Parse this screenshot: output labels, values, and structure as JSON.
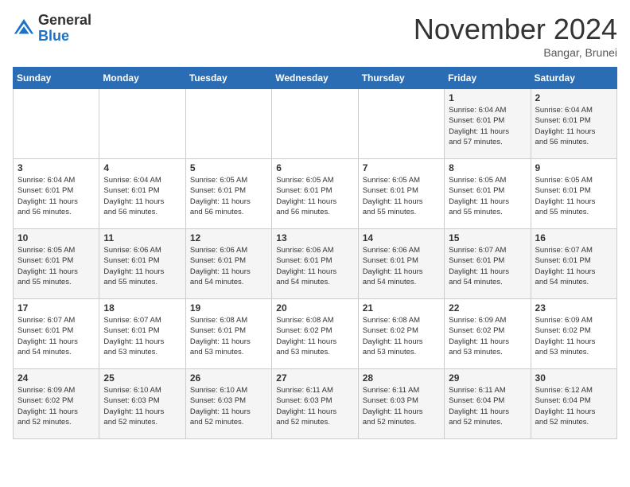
{
  "header": {
    "logo_general": "General",
    "logo_blue": "Blue",
    "month_title": "November 2024",
    "location": "Bangar, Brunei"
  },
  "weekdays": [
    "Sunday",
    "Monday",
    "Tuesday",
    "Wednesday",
    "Thursday",
    "Friday",
    "Saturday"
  ],
  "weeks": [
    [
      {
        "day": "",
        "info": ""
      },
      {
        "day": "",
        "info": ""
      },
      {
        "day": "",
        "info": ""
      },
      {
        "day": "",
        "info": ""
      },
      {
        "day": "",
        "info": ""
      },
      {
        "day": "1",
        "info": "Sunrise: 6:04 AM\nSunset: 6:01 PM\nDaylight: 11 hours\nand 57 minutes."
      },
      {
        "day": "2",
        "info": "Sunrise: 6:04 AM\nSunset: 6:01 PM\nDaylight: 11 hours\nand 56 minutes."
      }
    ],
    [
      {
        "day": "3",
        "info": "Sunrise: 6:04 AM\nSunset: 6:01 PM\nDaylight: 11 hours\nand 56 minutes."
      },
      {
        "day": "4",
        "info": "Sunrise: 6:04 AM\nSunset: 6:01 PM\nDaylight: 11 hours\nand 56 minutes."
      },
      {
        "day": "5",
        "info": "Sunrise: 6:05 AM\nSunset: 6:01 PM\nDaylight: 11 hours\nand 56 minutes."
      },
      {
        "day": "6",
        "info": "Sunrise: 6:05 AM\nSunset: 6:01 PM\nDaylight: 11 hours\nand 56 minutes."
      },
      {
        "day": "7",
        "info": "Sunrise: 6:05 AM\nSunset: 6:01 PM\nDaylight: 11 hours\nand 55 minutes."
      },
      {
        "day": "8",
        "info": "Sunrise: 6:05 AM\nSunset: 6:01 PM\nDaylight: 11 hours\nand 55 minutes."
      },
      {
        "day": "9",
        "info": "Sunrise: 6:05 AM\nSunset: 6:01 PM\nDaylight: 11 hours\nand 55 minutes."
      }
    ],
    [
      {
        "day": "10",
        "info": "Sunrise: 6:05 AM\nSunset: 6:01 PM\nDaylight: 11 hours\nand 55 minutes."
      },
      {
        "day": "11",
        "info": "Sunrise: 6:06 AM\nSunset: 6:01 PM\nDaylight: 11 hours\nand 55 minutes."
      },
      {
        "day": "12",
        "info": "Sunrise: 6:06 AM\nSunset: 6:01 PM\nDaylight: 11 hours\nand 54 minutes."
      },
      {
        "day": "13",
        "info": "Sunrise: 6:06 AM\nSunset: 6:01 PM\nDaylight: 11 hours\nand 54 minutes."
      },
      {
        "day": "14",
        "info": "Sunrise: 6:06 AM\nSunset: 6:01 PM\nDaylight: 11 hours\nand 54 minutes."
      },
      {
        "day": "15",
        "info": "Sunrise: 6:07 AM\nSunset: 6:01 PM\nDaylight: 11 hours\nand 54 minutes."
      },
      {
        "day": "16",
        "info": "Sunrise: 6:07 AM\nSunset: 6:01 PM\nDaylight: 11 hours\nand 54 minutes."
      }
    ],
    [
      {
        "day": "17",
        "info": "Sunrise: 6:07 AM\nSunset: 6:01 PM\nDaylight: 11 hours\nand 54 minutes."
      },
      {
        "day": "18",
        "info": "Sunrise: 6:07 AM\nSunset: 6:01 PM\nDaylight: 11 hours\nand 53 minutes."
      },
      {
        "day": "19",
        "info": "Sunrise: 6:08 AM\nSunset: 6:01 PM\nDaylight: 11 hours\nand 53 minutes."
      },
      {
        "day": "20",
        "info": "Sunrise: 6:08 AM\nSunset: 6:02 PM\nDaylight: 11 hours\nand 53 minutes."
      },
      {
        "day": "21",
        "info": "Sunrise: 6:08 AM\nSunset: 6:02 PM\nDaylight: 11 hours\nand 53 minutes."
      },
      {
        "day": "22",
        "info": "Sunrise: 6:09 AM\nSunset: 6:02 PM\nDaylight: 11 hours\nand 53 minutes."
      },
      {
        "day": "23",
        "info": "Sunrise: 6:09 AM\nSunset: 6:02 PM\nDaylight: 11 hours\nand 53 minutes."
      }
    ],
    [
      {
        "day": "24",
        "info": "Sunrise: 6:09 AM\nSunset: 6:02 PM\nDaylight: 11 hours\nand 52 minutes."
      },
      {
        "day": "25",
        "info": "Sunrise: 6:10 AM\nSunset: 6:03 PM\nDaylight: 11 hours\nand 52 minutes."
      },
      {
        "day": "26",
        "info": "Sunrise: 6:10 AM\nSunset: 6:03 PM\nDaylight: 11 hours\nand 52 minutes."
      },
      {
        "day": "27",
        "info": "Sunrise: 6:11 AM\nSunset: 6:03 PM\nDaylight: 11 hours\nand 52 minutes."
      },
      {
        "day": "28",
        "info": "Sunrise: 6:11 AM\nSunset: 6:03 PM\nDaylight: 11 hours\nand 52 minutes."
      },
      {
        "day": "29",
        "info": "Sunrise: 6:11 AM\nSunset: 6:04 PM\nDaylight: 11 hours\nand 52 minutes."
      },
      {
        "day": "30",
        "info": "Sunrise: 6:12 AM\nSunset: 6:04 PM\nDaylight: 11 hours\nand 52 minutes."
      }
    ]
  ]
}
